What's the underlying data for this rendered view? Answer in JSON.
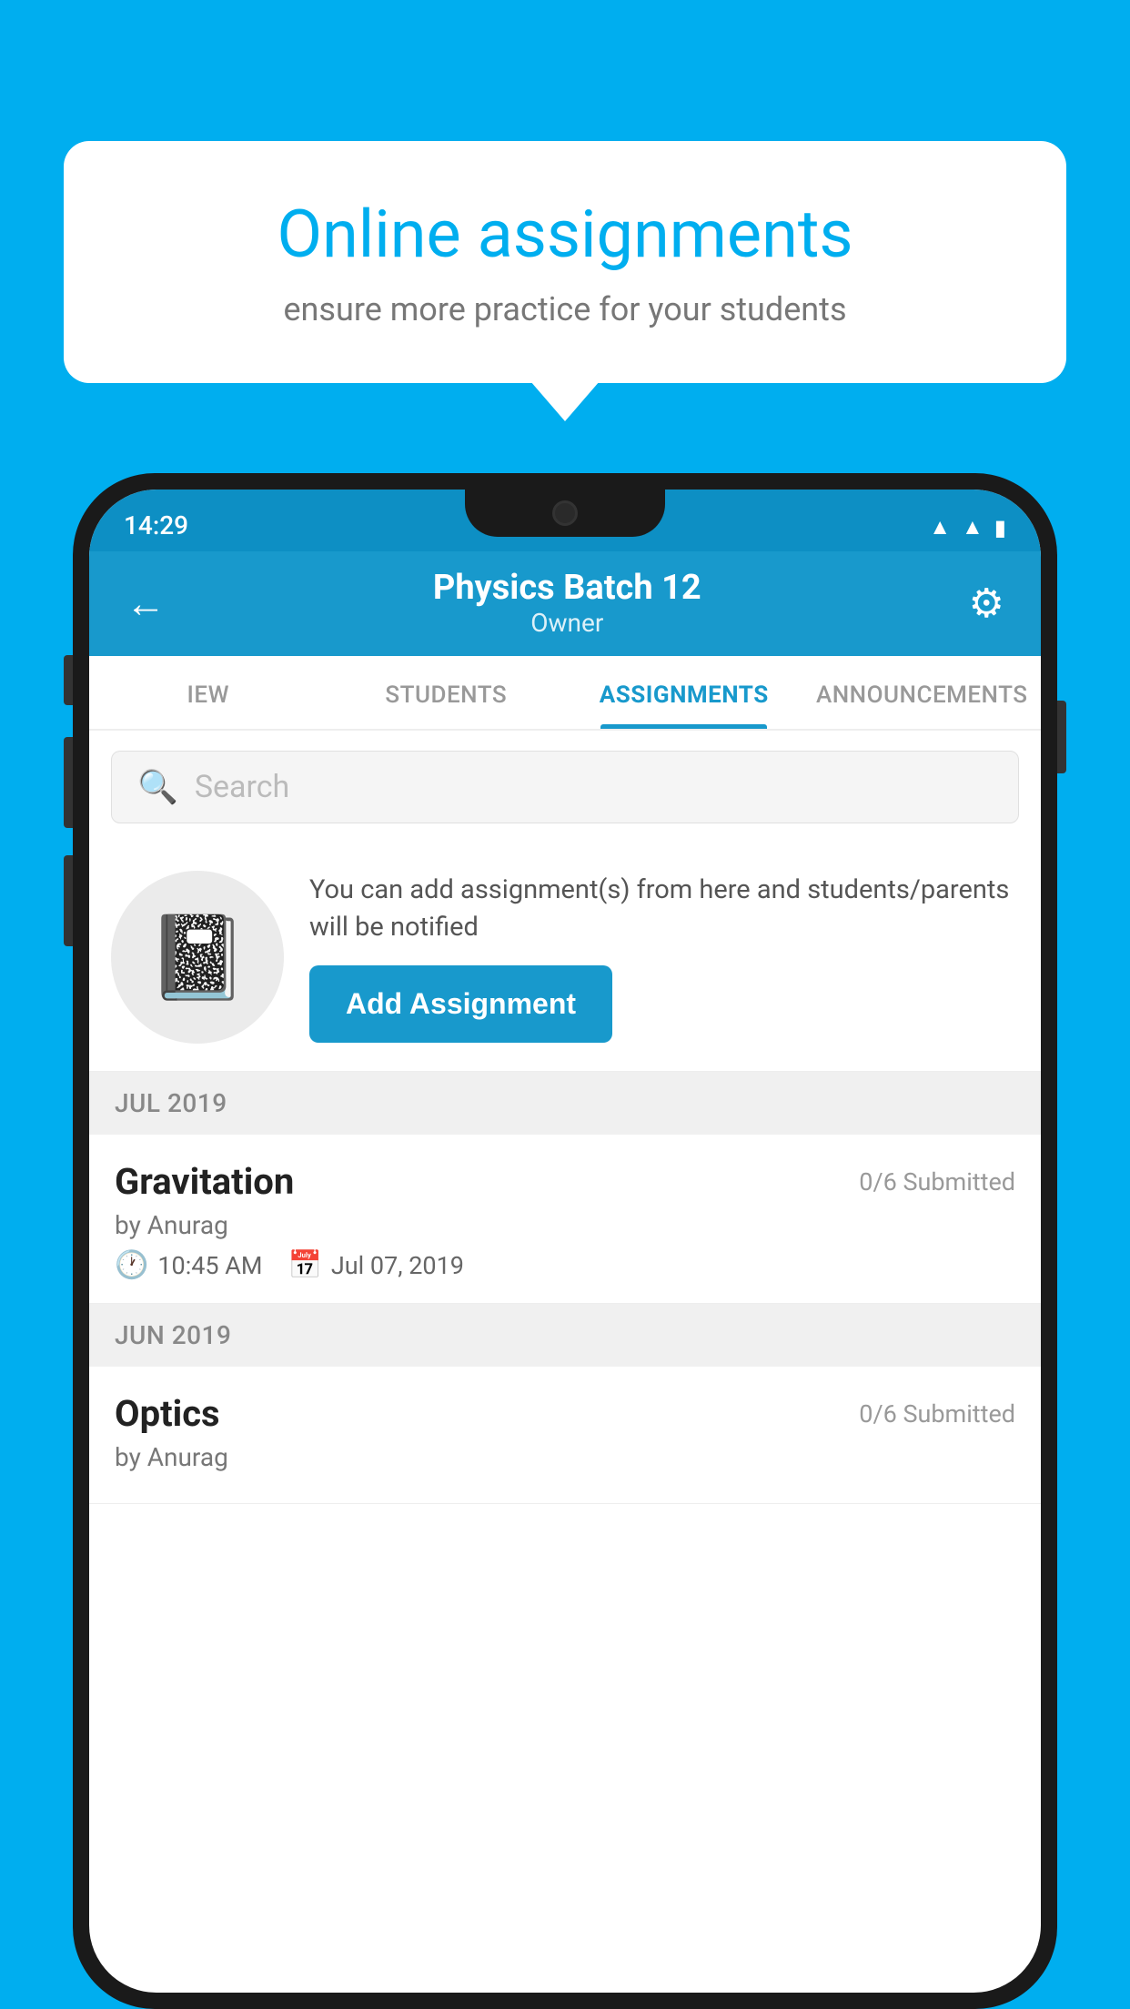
{
  "background_color": "#00AEEF",
  "speech_bubble": {
    "title": "Online assignments",
    "subtitle": "ensure more practice for your students"
  },
  "phone": {
    "status_bar": {
      "time": "14:29",
      "icons": [
        "wifi",
        "signal",
        "battery"
      ]
    },
    "header": {
      "title": "Physics Batch 12",
      "subtitle": "Owner",
      "back_label": "←",
      "gear_label": "⚙"
    },
    "tabs": [
      {
        "label": "IEW",
        "active": false
      },
      {
        "label": "STUDENTS",
        "active": false
      },
      {
        "label": "ASSIGNMENTS",
        "active": true
      },
      {
        "label": "ANNOUNCEMENTS",
        "active": false
      }
    ],
    "search": {
      "placeholder": "Search"
    },
    "add_assignment_section": {
      "description": "You can add assignment(s) from here and students/parents will be notified",
      "button_label": "Add Assignment"
    },
    "assignments": [
      {
        "month_label": "JUL 2019",
        "items": [
          {
            "name": "Gravitation",
            "submitted": "0/6 Submitted",
            "by": "by Anurag",
            "time": "10:45 AM",
            "date": "Jul 07, 2019"
          }
        ]
      },
      {
        "month_label": "JUN 2019",
        "items": [
          {
            "name": "Optics",
            "submitted": "0/6 Submitted",
            "by": "by Anurag",
            "time": "",
            "date": ""
          }
        ]
      }
    ]
  }
}
